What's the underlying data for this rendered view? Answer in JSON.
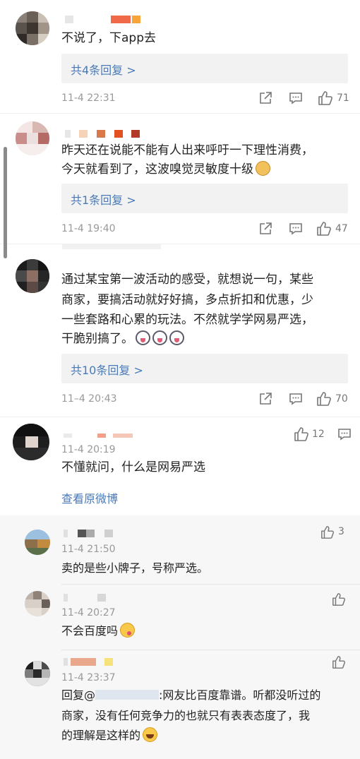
{
  "comments": [
    {
      "text_lines": [
        "不说了，下app去"
      ],
      "reply_label": "共4条回复 >",
      "time": "11-4 22:31",
      "likes": "71"
    },
    {
      "text_lines": [
        "昨天还在说能不能有人出来呼吁一下理性消费，",
        "今天就看到了，这波嗅觉灵敏度十级"
      ],
      "reply_label": "共1条回复 >",
      "time": "11-4 19:40",
      "likes": "47"
    },
    {
      "text_lines": [
        "通过某宝第一波活动的感受，就想说一句，某些",
        "商家，要搞活动就好好搞，多点折扣和优惠，少",
        "一些套路和心累的玩法。不然就学学网易严选，",
        "干脆别搞了。"
      ],
      "reply_label": "共10条回复 >",
      "time": "11–4 20:43",
      "likes": "70"
    },
    {
      "time": "11-4 20:19",
      "likes": "12",
      "text_lines": [
        "不懂就问，什么是网易严选"
      ],
      "link_label": "查看原微博"
    }
  ],
  "subreplies": [
    {
      "time": "11-4 21:50",
      "likes": "3",
      "text": "卖的是些小牌子，号称严选。"
    },
    {
      "time": "11-4 20:27",
      "likes": "",
      "text": "不会百度吗"
    },
    {
      "time": "11-4 23:37",
      "likes": "",
      "text_lines": [
        "回复@",
        ":网友比百度靠谱。听都没听过的",
        "商家，没有任何竞争力的也就只有表表态度了，我",
        "的理解是这样的"
      ]
    }
  ],
  "icons": [
    "share-icon",
    "comment-icon",
    "like-icon",
    "cat-emoji",
    "husky-emoji",
    "yum-emoji",
    "laugh-emoji"
  ],
  "colors": {
    "link": "#4a7ab7",
    "meta": "#999999",
    "reply_bg": "#f2f2f2",
    "sub_bg": "#f7f7f7"
  }
}
